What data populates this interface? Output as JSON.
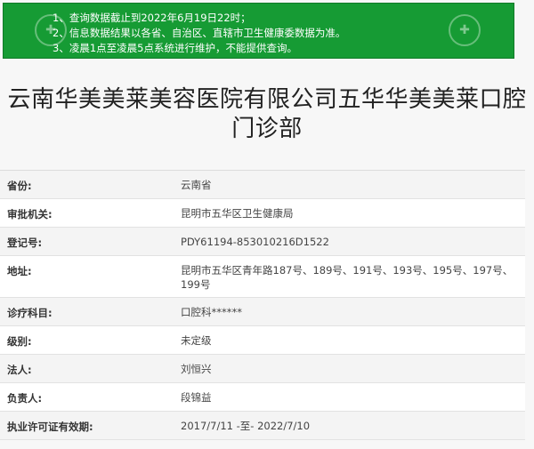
{
  "notice": {
    "lines": [
      "1、查询数据截止到2022年6月19日22时；",
      "2、信息数据结果以各省、自治区、直辖市卫生健康委数据为准。",
      "3、凌晨1点至凌晨5点系统进行维护，不能提供查询。"
    ]
  },
  "title": "云南华美美莱美容医院有限公司五华华美美莱口腔门诊部",
  "details": [
    {
      "label": "省份:",
      "value": "云南省"
    },
    {
      "label": "审批机关:",
      "value": "昆明市五华区卫生健康局"
    },
    {
      "label": "登记号:",
      "value": "PDY61194-853010216D1522"
    },
    {
      "label": "地址:",
      "value": "昆明市五华区青年路187号、189号、191号、193号、195号、197号、199号"
    },
    {
      "label": "诊疗科目:",
      "value": "口腔科******"
    },
    {
      "label": "级别:",
      "value": "未定级"
    },
    {
      "label": "法人:",
      "value": "刘恒兴"
    },
    {
      "label": "负责人:",
      "value": "段锦益"
    },
    {
      "label": "执业许可证有效期:",
      "value": "2017/7/11 -至- 2022/7/10"
    }
  ],
  "colors": {
    "notice_bg": "#169b34",
    "accent": "#117a28"
  }
}
